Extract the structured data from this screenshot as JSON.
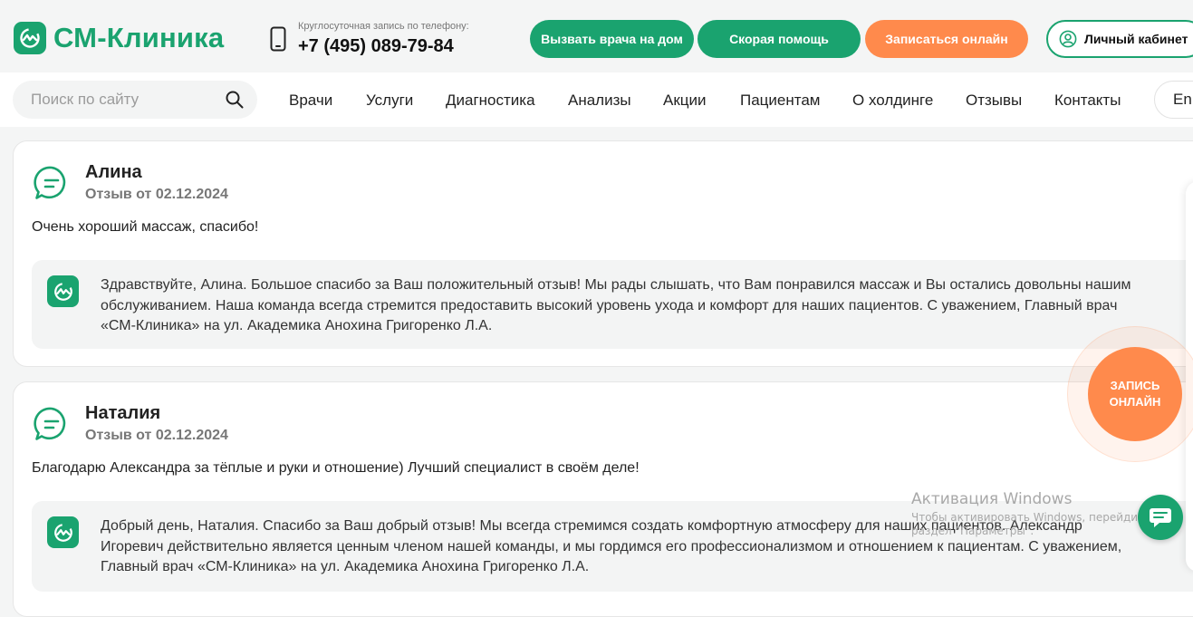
{
  "header": {
    "logo_text": "СМ-Клиника",
    "phone_caption": "Круглосуточная запись по телефону:",
    "phone_number": "+7 (495) 089-79-84",
    "buttons": {
      "doctor_home": "Вызвать врача на дом",
      "ambulance": "Скорая помощь",
      "book_online": "Записаться онлайн",
      "cabinet": "Личный кабинет"
    }
  },
  "nav": {
    "search_placeholder": "Поиск по сайту",
    "items": [
      "Врачи",
      "Услуги",
      "Диагностика",
      "Анализы",
      "Акции",
      "Пациентам",
      "О холдинге",
      "Отзывы",
      "Контакты"
    ],
    "lang": "En"
  },
  "reviews": [
    {
      "author": "Алина",
      "date": "Отзыв от 02.12.2024",
      "text": "Очень хороший массаж, спасибо!",
      "reply": "Здравствуйте, Алина. Большое спасибо за Ваш положительный отзыв! Мы рады слышать, что Вам понравился массаж и Вы остались довольны нашим обслуживанием. Наша команда всегда стремится предоставить высокий уровень ухода и комфорт для наших пациентов. С уважением, Главный врач «СМ-Клиника» на ул. Академика Анохина Григоренко Л.А."
    },
    {
      "author": "Наталия",
      "date": "Отзыв от 02.12.2024",
      "text": "Благодарю Александра за тёплые и руки и отношение) Лучший специалист в своём деле!",
      "reply": "Добрый день, Наталия. Спасибо за Ваш добрый отзыв! Мы всегда стремимся создать комфортную атмосферу для наших пациентов. Александр Игоревич действительно является ценным членом нашей команды, и мы гордимся его профессионализмом и отношением к пациентам. С уважением, Главный врач «СМ-Клиника» на ул. Академика Анохина Григоренко Л.А."
    }
  ],
  "floating": {
    "online_line1": "ЗАПИСЬ",
    "online_line2": "ОНЛАЙН"
  },
  "windows_watermark": {
    "title": "Активация Windows",
    "line1": "Чтобы активировать Windows, перейдите в",
    "line2": "раздел \"Параметры\"."
  },
  "colors": {
    "brand_green": "#1aa36f",
    "accent_orange": "#ff8a4c"
  }
}
